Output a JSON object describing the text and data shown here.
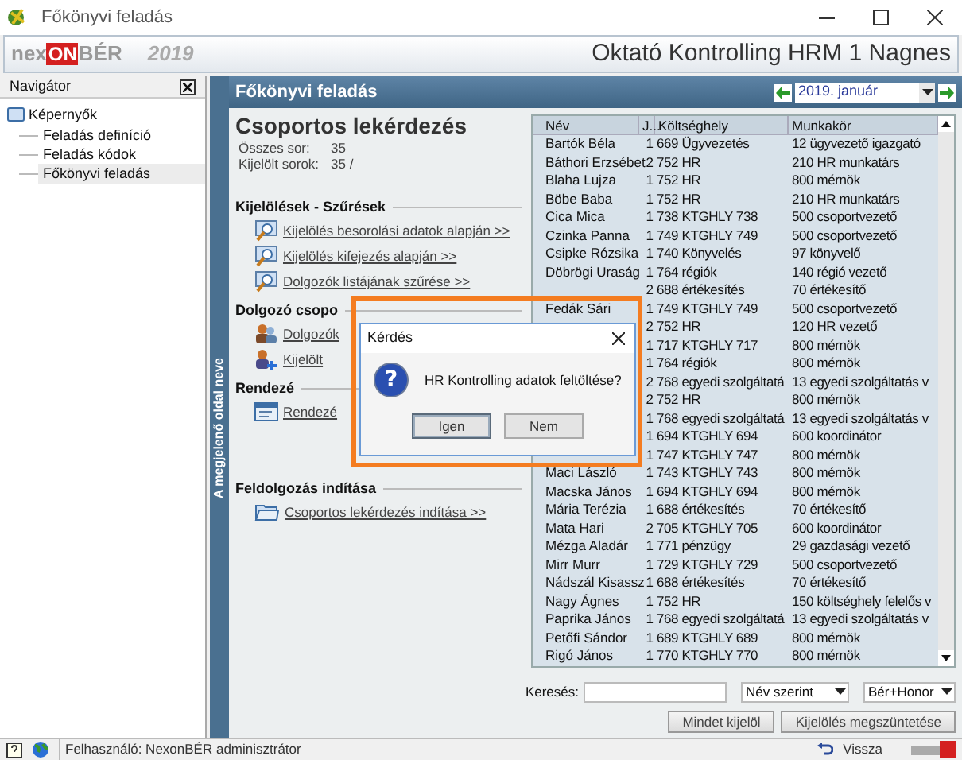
{
  "window": {
    "title": "Főkönyvi feladás"
  },
  "banner": {
    "logo_prefix": "nex",
    "logo_mid": "ON",
    "logo_suffix": "BÉR",
    "year": "2019",
    "company": "Oktató Kontrolling HRM 1 Nagnes"
  },
  "navigator": {
    "title": "Navigátor",
    "items": [
      {
        "label": "Képernyők",
        "children": [
          {
            "label": "Feladás definíció",
            "selected": false
          },
          {
            "label": "Feladás kódok",
            "selected": false
          },
          {
            "label": "Főkönyvi feladás",
            "selected": true
          }
        ]
      }
    ]
  },
  "side_strip": "A megjelenő oldal neve",
  "panel": {
    "title": "Főkönyvi feladás",
    "period": "2019. január"
  },
  "query_title": "Csoportos lekérdezés",
  "summary": [
    {
      "label": "Összes sor:",
      "value": "35"
    },
    {
      "label": "Kijelölt sorok:",
      "value": "35 /"
    }
  ],
  "sections": [
    {
      "title": "Kijelölések - Szűrések",
      "links": [
        {
          "kind": "search",
          "label": "Kijelölés besorolási adatok alapján >>"
        },
        {
          "kind": "search",
          "label": "Kijelölés kifejezés alapján >>"
        },
        {
          "kind": "search",
          "label": "Dolgozók listájának szűrése >>"
        }
      ]
    },
    {
      "title": "Dolgozó csopo",
      "links": [
        {
          "kind": "people",
          "label": "Dolgozók"
        },
        {
          "kind": "people_add",
          "label": "Kijelölt"
        }
      ]
    },
    {
      "title": "Rendezé",
      "links": [
        {
          "kind": "sort",
          "label": "Rendezé"
        }
      ]
    },
    {
      "title": "Feldolgozás indítása",
      "links": [
        {
          "kind": "folder",
          "label": "Csoportos lekérdezés indítása >>"
        }
      ]
    }
  ],
  "table": {
    "columns": [
      "Név",
      "J...",
      "Költséghely",
      "Munkakör"
    ],
    "rows": [
      {
        "name": "Bartók Béla",
        "j": "1",
        "cost": "669 Ügyvezetés",
        "job": "12 ügyvezető igazgató"
      },
      {
        "name": "Báthori Erzsébet",
        "j": "2",
        "cost": "752 HR",
        "job": "210 HR munkatárs"
      },
      {
        "name": "Blaha Lujza",
        "j": "1",
        "cost": "752 HR",
        "job": "800 mérnök"
      },
      {
        "name": "Böbe Baba",
        "j": "1",
        "cost": "752 HR",
        "job": "210 HR munkatárs"
      },
      {
        "name": "Cica Mica",
        "j": "1",
        "cost": "738 KTGHLY 738",
        "job": "500 csoportvezető"
      },
      {
        "name": "Czinka Panna",
        "j": "1",
        "cost": "749 KTGHLY 749",
        "job": "500 csoportvezető"
      },
      {
        "name": "Csipke Rózsika",
        "j": "1",
        "cost": "740 Könyvelés",
        "job": "97 könyvelő"
      },
      {
        "name": "Döbrögi Uraság",
        "j": "1",
        "cost": "764 régiók",
        "job": "140 régió vezető"
      },
      {
        "j": "2",
        "cost": "688 értékesítés",
        "job": "70 értékesítő"
      },
      {
        "name": "Fedák Sári",
        "j": "1",
        "cost": "749 KTGHLY 749",
        "job": "500 csoportvezető"
      },
      {
        "j": "2",
        "cost": "752 HR",
        "job": "120 HR vezető"
      },
      {
        "j": "1",
        "cost": "717 KTGHLY 717",
        "job": "800 mérnök"
      },
      {
        "j": "1",
        "cost": "764 régiók",
        "job": "800 mérnök"
      },
      {
        "j": "2",
        "cost": "768 egyedi szolgáltatá",
        "job": "13 egyedi szolgáltatás v"
      },
      {
        "j": "2",
        "cost": "752 HR",
        "job": "800 mérnök"
      },
      {
        "j": "1",
        "cost": "768 egyedi szolgáltatá",
        "job": "13 egyedi szolgáltatás v"
      },
      {
        "j": "1",
        "cost": "694 KTGHLY 694",
        "job": "600 koordinátor"
      },
      {
        "j": "1",
        "cost": "747 KTGHLY 747",
        "job": "800 mérnök"
      },
      {
        "name": "Maci László",
        "j": "1",
        "cost": "743 KTGHLY 743",
        "job": "800 mérnök"
      },
      {
        "name": "Macska János",
        "j": "1",
        "cost": "694 KTGHLY 694",
        "job": "800 mérnök"
      },
      {
        "name": "Mária Terézia",
        "j": "1",
        "cost": "688 értékesítés",
        "job": "70 értékesítő"
      },
      {
        "name": "Mata Hari",
        "j": "2",
        "cost": "705 KTGHLY 705",
        "job": "600 koordinátor"
      },
      {
        "name": "Mézga Aladár",
        "j": "1",
        "cost": "771 pénzügy",
        "job": "29 gazdasági vezető"
      },
      {
        "name": "Mirr Murr",
        "j": "1",
        "cost": "729 KTGHLY 729",
        "job": "500 csoportvezető"
      },
      {
        "name": "Nádszál Kisassz",
        "j": "1",
        "cost": "688 értékesítés",
        "job": "70 értékesítő"
      },
      {
        "name": "Nagy Ágnes",
        "j": "1",
        "cost": "752 HR",
        "job": "150 költséghely felelős v"
      },
      {
        "name": "Paprika János",
        "j": "1",
        "cost": "768 egyedi szolgáltatá",
        "job": "13 egyedi szolgáltatás v"
      },
      {
        "name": "Petőfi Sándor",
        "j": "1",
        "cost": "689 KTGHLY 689",
        "job": "800 mérnök"
      },
      {
        "name": "Rigó János",
        "j": "1",
        "cost": "770 KTGHLY 770",
        "job": "800 mérnök"
      }
    ]
  },
  "search": {
    "label": "Keresés:",
    "order": "Név szerint",
    "type": "Bér+Honor"
  },
  "buttons": [
    "Mindet kijelöl",
    "Kijelölés megszüntetése"
  ],
  "status": {
    "user": "Felhasználó: NexonBÉR adminisztrátor",
    "back": "Vissza"
  },
  "dialog": {
    "title": "Kérdés",
    "icon_glyph": "?",
    "message": "HR Kontrolling adatok feltöltése?",
    "buttons": [
      {
        "label": "Igen",
        "selected": true
      },
      {
        "label": "Nem",
        "selected": false
      }
    ]
  }
}
